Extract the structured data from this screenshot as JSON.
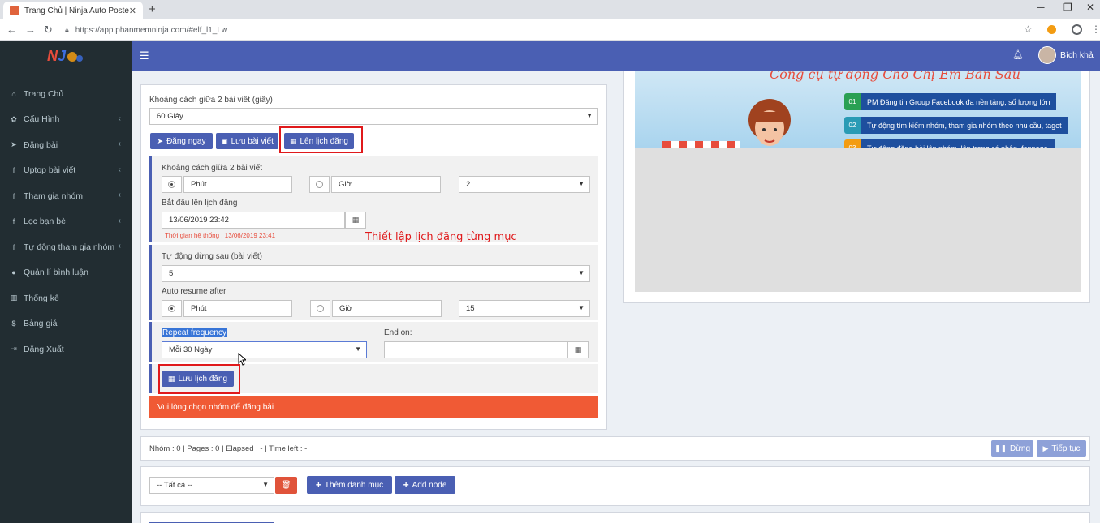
{
  "browser": {
    "tab_title": "Trang Chủ | Ninja Auto Poster",
    "url": "https://app.phanmemninja.com/#elf_l1_Lw"
  },
  "sidebar": {
    "items": [
      {
        "label": "Trang Chủ",
        "icon": "home-icon",
        "glyph": "⌂",
        "chevron": false
      },
      {
        "label": "Cấu Hình",
        "icon": "gear-icon",
        "glyph": "✿",
        "chevron": true
      },
      {
        "label": "Đăng bài",
        "icon": "send-icon",
        "glyph": "➤",
        "chevron": true
      },
      {
        "label": "Uptop bài viết",
        "icon": "facebook-icon",
        "glyph": "f",
        "chevron": true
      },
      {
        "label": "Tham gia nhóm",
        "icon": "facebook-icon",
        "glyph": "f",
        "chevron": true
      },
      {
        "label": "Lọc bạn bè",
        "icon": "facebook-icon",
        "glyph": "f",
        "chevron": true
      },
      {
        "label": "Tự động tham gia nhóm",
        "icon": "facebook-icon",
        "glyph": "f",
        "chevron": true
      },
      {
        "label": "Quản lí bình luận",
        "icon": "comment-icon",
        "glyph": "●",
        "chevron": false
      },
      {
        "label": "Thống kê",
        "icon": "bar-chart-icon",
        "glyph": "▥",
        "chevron": false
      },
      {
        "label": "Bảng giá",
        "icon": "dollar-icon",
        "glyph": "$",
        "chevron": false
      },
      {
        "label": "Đăng Xuất",
        "icon": "sign-out-icon",
        "glyph": "⇥",
        "chevron": false
      }
    ]
  },
  "header": {
    "user_name": "Bích khả"
  },
  "form": {
    "interval_label": "Khoảng cách giữa 2 bài viết (giây)",
    "interval_value": "60 Giây",
    "buttons": {
      "post_now": "Đăng ngay",
      "save_post": "Lưu bài viết",
      "schedule": "Lên lịch đăng"
    },
    "schedule": {
      "interval_label": "Khoảng cách giữa 2 bài viết",
      "unit_minute": "Phút",
      "unit_hour": "Giờ",
      "interval_value": "2",
      "start_label": "Bắt đầu lên lịch đăng",
      "start_value": "13/06/2019 23:42",
      "system_time": "Thời gian hệ thống : 13/06/2019 23:41",
      "annotation": "Thiết lập lịch đăng từng mục",
      "auto_stop_label": "Tự động dừng sau (bài viết)",
      "auto_stop_value": "5",
      "auto_resume_label": "Auto resume after",
      "resume_minute": "Phút",
      "resume_hour": "Giờ",
      "resume_value": "15",
      "repeat_label": "Repeat frequency",
      "repeat_value": "Mỗi 30 Ngày",
      "end_on_label": "End on:",
      "end_on_value": "",
      "save_schedule": "Lưu lịch đăng"
    },
    "alert": "Vui lòng chọn nhóm để đăng bài"
  },
  "banner": {
    "title": "Công cụ tự động Cho Chị Em Bán Sầu",
    "features": [
      {
        "num": "01",
        "text": "PM Đăng tin Group Facebook đa nền tảng, số lượng lớn"
      },
      {
        "num": "02",
        "text": "Tự động tìm kiếm nhóm, tham gia nhóm theo nhu cầu, taget"
      },
      {
        "num": "03",
        "text": "Tự động đăng bài lên nhóm, lên trang cá nhân, fanpage"
      }
    ]
  },
  "status_bar": {
    "text": "Nhóm : 0 | Pages : 0 | Elapsed : - | Time left : -",
    "stop": "Dừng",
    "continue": "Tiếp tục"
  },
  "category_bar": {
    "filter_value": "-- Tất cả --",
    "add_category": "Thêm danh mục",
    "add_node": "Add node"
  },
  "colors": {
    "primary": "#4a5fb3",
    "sidebar": "#222d32",
    "alert": "#f05a35",
    "highlight": "#e0191b"
  }
}
